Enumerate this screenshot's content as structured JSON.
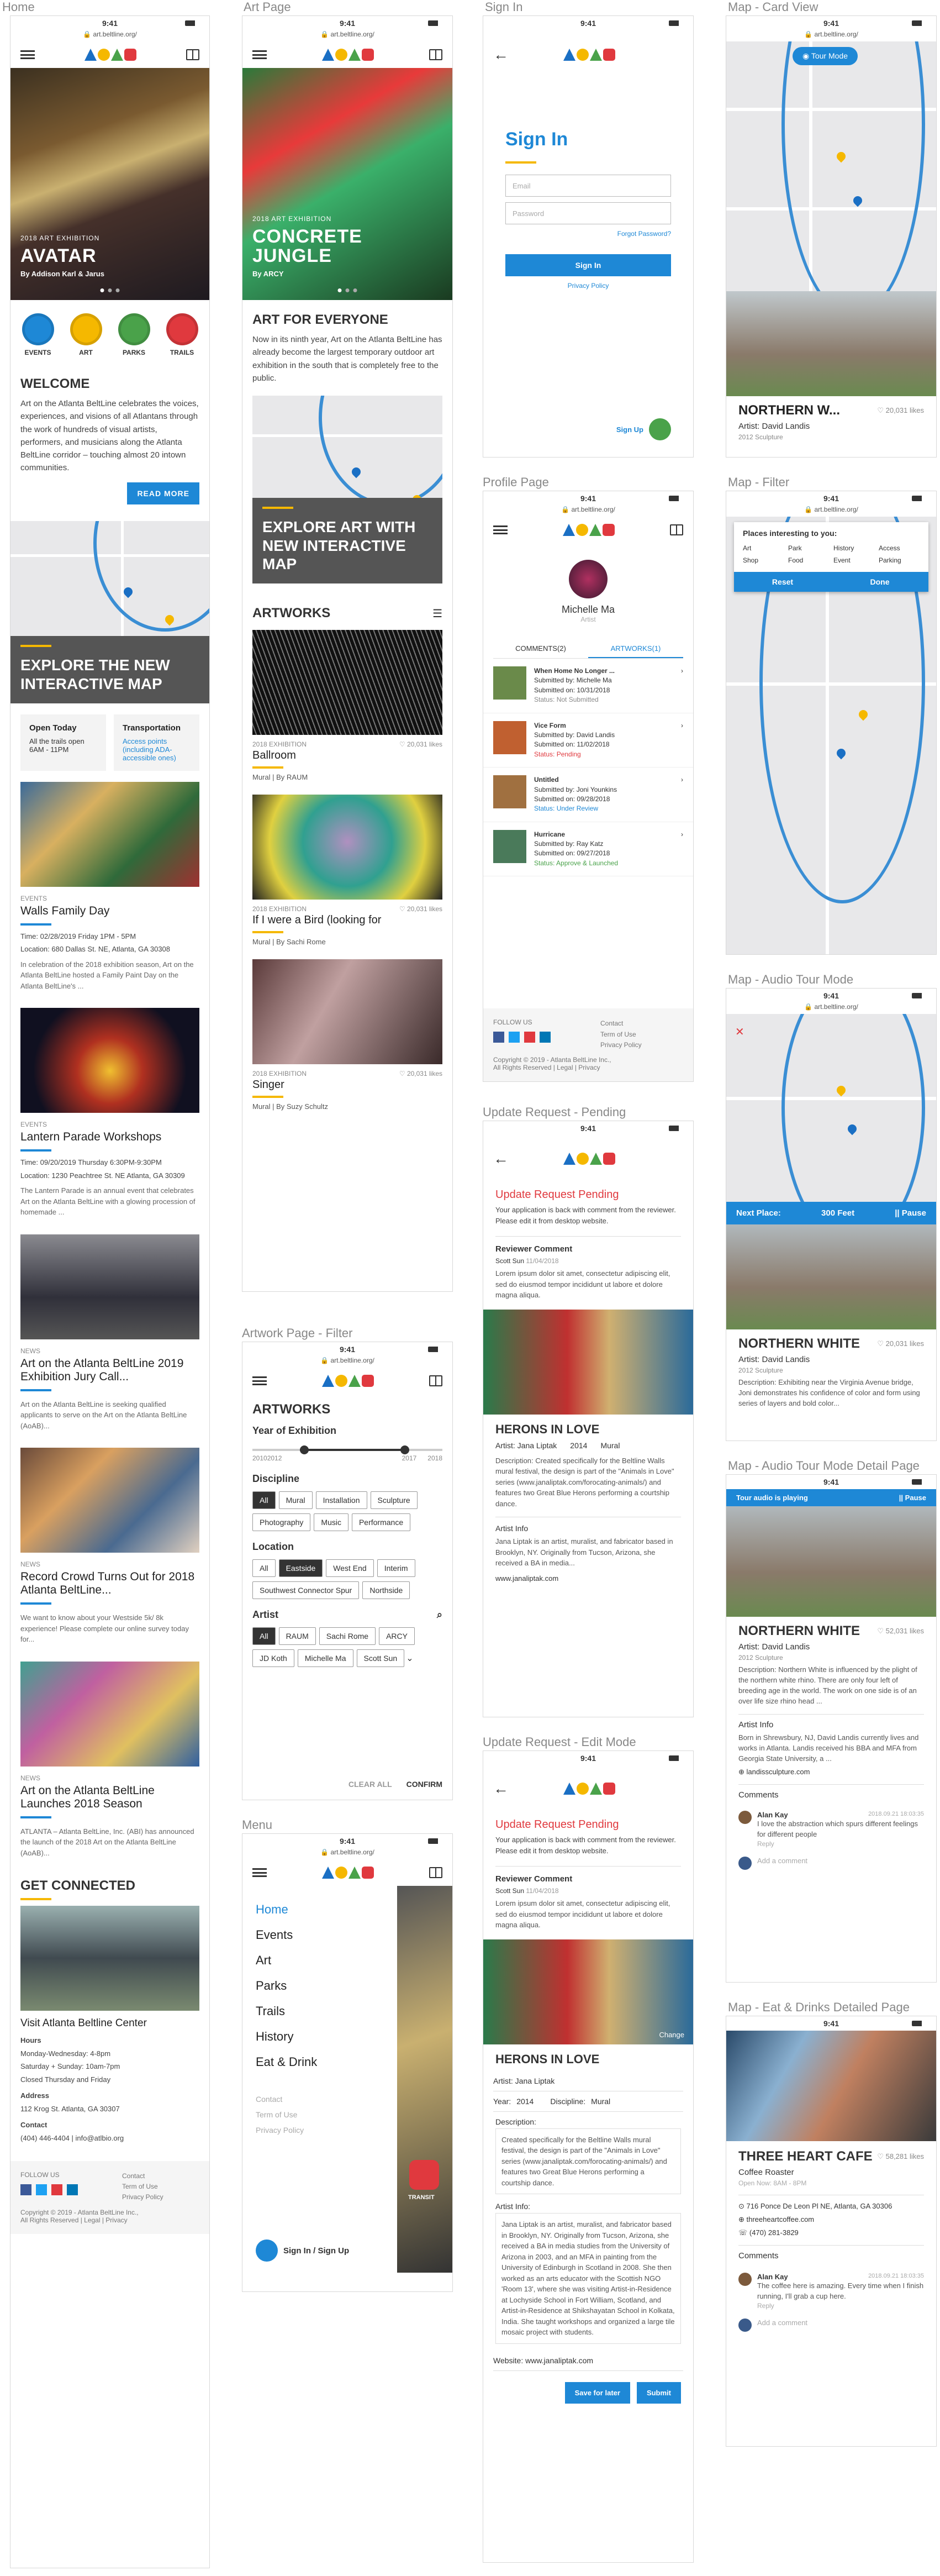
{
  "columns": [
    "Home",
    "Art Page",
    "Sign In",
    "Map - Card View"
  ],
  "section_titles": {
    "profile": "Profile Page",
    "art_filter": "Artwork Page - Filter",
    "menu": "Menu",
    "update_pending": "Update Request - Pending",
    "update_edit": "Update Request - Edit Mode",
    "map_filter": "Map - Filter",
    "audio_tour": "Map - Audio Tour Mode",
    "audio_detail": "Map - Audio Tour Mode Detail Page",
    "eat_drinks": "Map - Eat & Drinks Detailed Page"
  },
  "status": {
    "time": "9:41",
    "url": "🔒 art.beltline.org/"
  },
  "home": {
    "hero_small": "2018 ART EXHIBITION",
    "hero_title": "AVATAR",
    "hero_by": "By Addison Karl & Jarus",
    "categories": [
      "EVENTS",
      "ART",
      "PARKS",
      "TRAILS"
    ],
    "category_colors": [
      "#1e88d6",
      "#f5b800",
      "#4aa24a",
      "#e0393e"
    ],
    "welcome_title": "WELCOME",
    "welcome_text": "Art on the Atlanta BeltLine celebrates the voices, experiences, and visions of all Atlantans through the work of hundreds of visual artists, performers, and musicians along the Atlanta BeltLine corridor – touching almost 20 intown communities.",
    "read_more": "READ MORE",
    "map_banner": "EXPLORE THE NEW INTERACTIVE MAP",
    "open_today_title": "Open Today",
    "open_today_text": "All the trails open 6AM - 11PM",
    "transport_title": "Transportation",
    "transport_text": "Access points (including ADA-accessible ones)",
    "events": [
      {
        "cat": "EVENTS",
        "title": "Walls Family Day",
        "time": "Time: 02/28/2019 Friday 1PM - 5PM",
        "loc": "Location: 680 Dallas St. NE, Atlanta, GA 30308",
        "desc": "In celebration of the 2018 exhibition season, Art on the Atlanta BeltLine hosted a Family Paint Day on the Atlanta BeltLine's ..."
      },
      {
        "cat": "EVENTS",
        "title": "Lantern Parade Workshops",
        "time": "Time: 09/20/2019 Thursday 6:30PM-9:30PM",
        "loc": "Location: 1230 Peachtree St. NE Atlanta, GA 30309",
        "desc": "The Lantern Parade is an annual event that celebrates Art on the Atlanta BeltLine with a glowing procession of homemade ..."
      },
      {
        "cat": "NEWS",
        "title": "Art on the Atlanta BeltLine 2019 Exhibition Jury Call...",
        "time": "",
        "loc": "",
        "desc": "Art on the Atlanta BeltLine is seeking qualified applicants to serve on the Art on the Atlanta BeltLine (AoAB)..."
      },
      {
        "cat": "NEWS",
        "title": "Record Crowd Turns Out for 2018 Atlanta BeltLine...",
        "time": "",
        "loc": "",
        "desc": "We want to know about your Westside 5k/ 8k experience! Please complete our online survey today for..."
      },
      {
        "cat": "NEWS",
        "title": "Art on the Atlanta BeltLine Launches 2018 Season",
        "time": "",
        "loc": "",
        "desc": "ATLANTA – Atlanta BeltLine, Inc. (ABI) has announced the launch of the 2018 Art on the Atlanta BeltLine (AoAB)..."
      }
    ],
    "get_connected": "GET CONNECTED",
    "visit_title": "Visit Atlanta Beltline Center",
    "hours_label": "Hours",
    "hours": [
      "Monday-Wednesday: 4-8pm",
      "Saturday + Sunday: 10am-7pm",
      "Closed Thursday and Friday"
    ],
    "address_label": "Address",
    "address": "112 Krog St. Atlanta, GA 30307",
    "contact_label": "Contact",
    "contact": "(404) 446-4404 | info@atlbio.org"
  },
  "footer": {
    "follow": "FOLLOW US",
    "links": [
      "Contact",
      "Term of Use",
      "Privacy Policy"
    ],
    "copyright": "Copyright © 2019 - Atlanta BeltLine Inc.,",
    "rights": "All Rights Reserved | Legal | Privacy"
  },
  "art": {
    "hero_small": "2018 ART EXHIBITION",
    "hero_title": "CONCRETE JUNGLE",
    "hero_by": "By ARCY",
    "title": "ART FOR EVERYONE",
    "text": "Now in its ninth year, Art on the Atlanta BeltLine has already become the largest temporary outdoor art exhibition in the south that is completely free to the public.",
    "map_banner": "EXPLORE ART WITH NEW INTERACTIVE MAP",
    "artworks_title": "ARTWORKS",
    "items": [
      {
        "meta": "2018 EXHIBITION",
        "likes": "♡ 20,031 likes",
        "title": "Ballroom",
        "sub": "Mural  |  By RAUM"
      },
      {
        "meta": "2018 EXHIBITION",
        "likes": "♡ 20,031 likes",
        "title": "If I were a Bird (looking for",
        "sub": "Mural  |  By Sachi Rome"
      },
      {
        "meta": "2018 EXHIBITION",
        "likes": "♡ 20,031 likes",
        "title": "Singer",
        "sub": "Mural  |  By  Suzy Schultz"
      }
    ]
  },
  "filter": {
    "title": "ARTWORKS",
    "year_label": "Year of Exhibition",
    "years": [
      "2010",
      "2012",
      "2017",
      "2018"
    ],
    "discipline_label": "Discipline",
    "disciplines": [
      "All",
      "Mural",
      "Installation",
      "Sculpture",
      "Photography",
      "Music",
      "Performance"
    ],
    "location_label": "Location",
    "locations": [
      "All",
      "Eastside",
      "West End",
      "Interim",
      "Southwest Connector Spur",
      "Northside"
    ],
    "artist_label": "Artist",
    "artists": [
      "All",
      "RAUM",
      "Sachi Rome",
      "ARCY",
      "JD Koth",
      "Michelle Ma",
      "Scott Sun"
    ],
    "clear": "CLEAR ALL",
    "confirm": "CONFIRM"
  },
  "menu": {
    "items": [
      "Home",
      "Events",
      "Art",
      "Parks",
      "Trails",
      "History",
      "Eat & Drink"
    ],
    "sub": [
      "Contact",
      "Term of Use",
      "Privacy Policy"
    ],
    "signin": "Sign In / Sign Up",
    "transit": "TRANSIT"
  },
  "signin": {
    "title": "Sign In",
    "email": "Email",
    "password": "Password",
    "forgot": "Forgot Password?",
    "btn": "Sign In",
    "privacy": "Privacy Policy",
    "signup": "Sign Up"
  },
  "profile": {
    "name": "Michelle Ma",
    "role": "Artist",
    "tab_comments": "COMMENTS(2)",
    "tab_artworks": "ARTWORKS(1)",
    "subs": [
      {
        "title": "When Home No Longer ...",
        "by": "Submitted by: Michelle Ma",
        "on": "Submitted on: 10/31/2018",
        "status": "Status: Not Submitted",
        "color": "#888"
      },
      {
        "title": "Vice Form",
        "by": "Submitted by: David Landis",
        "on": "Submitted on: 11/02/2018",
        "status": "Status: Pending",
        "color": "#e0393e"
      },
      {
        "title": "Untitled",
        "by": "Submitted by: Joni Younkins",
        "on": "Submitted on: 09/28/2018",
        "status": "Status: Under Review",
        "color": "#1e88d6"
      },
      {
        "title": "Hurricane",
        "by": "Submitted by: Ray Katz",
        "on": "Submitted on: 09/27/2018",
        "status": "Status: Approve & Launched",
        "color": "#4aa24a"
      }
    ]
  },
  "pending": {
    "title": "Update Request Pending",
    "text": "Your application is back with comment from the reviewer. Please edit it from desktop website.",
    "rc_label": "Reviewer Comment",
    "reviewer": "Scott Sun",
    "date": "11/04/2018",
    "comment": "Lorem ipsum dolor sit amet, consectetur adipiscing elit, sed do eiusmod tempor incididunt ut labore et dolore magna aliqua.",
    "art_title": "HERONS IN LOVE",
    "artist": "Artist: Jana Liptak",
    "year": "2014",
    "disc": "Mural",
    "desc": "Description: Created specifically for the Beltline Walls mural festival, the design is part of the \"Animals in Love\" series (www.janaliptak.com/forocating-animals/) and features two Great Blue Herons performing a courtship dance.",
    "info_label": "Artist Info",
    "info": "Jana Liptak is an artist, muralist, and fabricator based in Brooklyn, NY. Originally from Tucson, Arizona, she received a BA in media...",
    "site": "www.janaliptak.com"
  },
  "edit": {
    "change": "Change",
    "name": "Jana Liptak",
    "year_label": "Year:",
    "year": "2014",
    "disc_label": "Discipline:",
    "disc": "Mural",
    "desc_label": "Description:",
    "desc": "Created specifically for the Beltline Walls mural festival, the design is part of the \"Animals in Love\" series (www.janaliptak.com/forocating-animals/) and features two Great Blue Herons performing a courtship dance.",
    "info_label": "Artist Info:",
    "info": "Jana Liptak is an artist, muralist, and fabricator based in Brooklyn, NY. Originally from Tucson, Arizona, she received a BA in media studies from the University of Arizona in 2003, and an MFA in painting from the University of Edinburgh in Scotland in 2008. She then worked as an arts educator with the Scottish NGO 'Room 13', where she was visiting Artist-in-Residence at Lochyside School in Fort William, Scotland, and Artist-in-Residence at Shikshayatan School in Kolkata, India. She taught workshops and organized a large tile mosaic project with students.",
    "website_label": "Website:",
    "website": "www.janaliptak.com",
    "save": "Save for later",
    "submit": "Submit"
  },
  "mapcard": {
    "tour": "Tour Mode",
    "title": "NORTHERN W...",
    "likes": "♡ 20,031 likes",
    "artist": "Artist: David Landis",
    "meta": "2012    Sculpture"
  },
  "mapfilter": {
    "title": "Places interesting to you:",
    "opts": [
      "Art",
      "Park",
      "History",
      "Access",
      "Shop",
      "Food",
      "Event",
      "Parking"
    ],
    "reset": "Reset",
    "done": "Done"
  },
  "audio": {
    "next": "Next Place:",
    "dist": "300 Feet",
    "pause": "|| Pause",
    "title": "NORTHERN WHITE",
    "likes": "♡ 20,031 likes",
    "artist": "Artist: David Landis",
    "meta": "2012    Sculpture",
    "desc": "Description: Exhibiting near the Virginia Avenue bridge, Joni demonstrates his confidence of color and form using series of layers and bold color..."
  },
  "detail": {
    "playing": "Tour audio is playing",
    "pause": "|| Pause",
    "title": "NORTHERN WHITE",
    "likes": "♡ 52,031 likes",
    "artist": "Artist: David Landis",
    "meta": "2012    Sculpture",
    "desc": "Description: Northern White is influenced by the plight of the northern white rhino. There are only four left of breeding age in the world. The work on one side is of an over life size rhino head ...",
    "info_label": "Artist Info",
    "info": "Born in Shrewsbury, NJ, David Landis currently lives and works in Atlanta. Landis received his BBA and MFA from Georgia State University, a ...",
    "site": "landissculpture.com",
    "comments_label": "Comments",
    "commenter": "Alan Kay",
    "cdate": "2018.09.21 18:03:35",
    "comment": "I love the abstraction which spurs different feelings for different people",
    "reply": "Reply",
    "add": "Add a comment"
  },
  "eat": {
    "title": "THREE HEART CAFE",
    "likes": "♡ 58,281 likes",
    "type": "Coffee Roaster",
    "hours": "Open Now: 8AM - 8PM",
    "addr": "716 Ponce De Leon Pl NE, Atlanta, GA 30306",
    "site": "threeheartcoffee.com",
    "phone": "(470) 281-3829",
    "comments_label": "Comments",
    "commenter": "Alan Kay",
    "cdate": "2018.09.21 18:03:35",
    "comment": "The coffee here is amazing. Every time when I finish running, I'll grab a cup here.",
    "reply": "Reply",
    "add": "Add a comment"
  }
}
